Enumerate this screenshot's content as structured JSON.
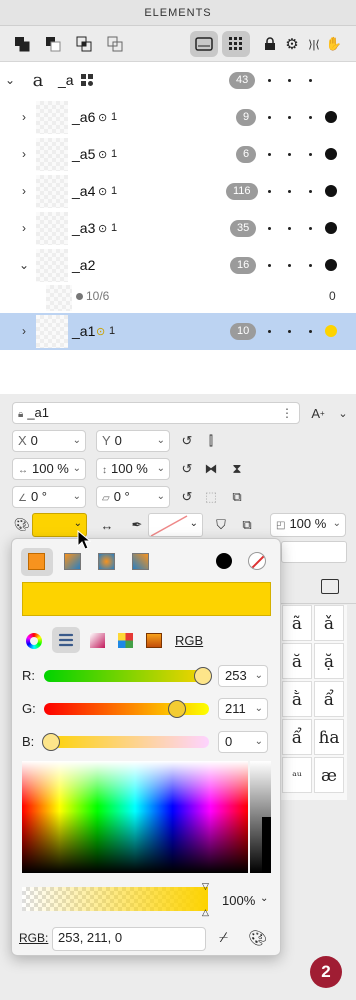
{
  "panel": {
    "title": "ELEMENTS"
  },
  "toolbar": {
    "icons": [
      "union-icon",
      "subtract-icon",
      "intersect-icon",
      "exclude-icon",
      "preview-icon",
      "grid-icon",
      "lock-icon",
      "gear-icon",
      "flip-icon",
      "hand-icon"
    ]
  },
  "layers": [
    {
      "name": "_a",
      "glyph": "a",
      "count": "43",
      "expanded": true,
      "has_component_icon": true,
      "icon": "component-icon"
    },
    {
      "name": "_a6",
      "count": "9",
      "links": "1",
      "icon": "link-icon"
    },
    {
      "name": "_a5",
      "count": "6",
      "links": "1",
      "icon": "link-icon"
    },
    {
      "name": "_a4",
      "count": "116",
      "links": "1",
      "icon": "link-icon"
    },
    {
      "name": "_a3",
      "count": "35",
      "links": "1",
      "icon": "link-icon"
    },
    {
      "name": "_a2",
      "count": "16",
      "expanded": true
    },
    {
      "name": "10/6",
      "trailing": "0",
      "sublayer": true
    },
    {
      "name": "_a1",
      "count": "10",
      "links": "1",
      "selected": true,
      "icon": "link-icon"
    }
  ],
  "properties": {
    "name_value": "_a1",
    "x_label": "X",
    "x_value": "0",
    "y_label": "Y",
    "y_value": "0",
    "width_value": "100 %",
    "height_value": "100 %",
    "rotation_value": "0 °",
    "skew_value": "0 °",
    "opacity_value": "100 %"
  },
  "color_picker": {
    "fill_modes": [
      "solid",
      "linear",
      "radial",
      "gradient"
    ],
    "color_hex": "#FDD300",
    "mode_tabs": [
      "wheel",
      "sliders",
      "gradient",
      "swatches",
      "image"
    ],
    "mode_label": "RGB",
    "r_label": "R:",
    "r_value": "253",
    "g_label": "G:",
    "g_value": "211",
    "b_label": "B:",
    "b_value": "0",
    "alpha_value": "100%",
    "rgb_label": "RGB:",
    "rgb_value": "253, 211, 0"
  },
  "glyphs": [
    "ã",
    "ǎ",
    "ă",
    "ặ",
    "ằ",
    "ẩ",
    "ẩ",
    "ɦa",
    "ᵃᵘ",
    "æ"
  ],
  "notification": {
    "count": "2"
  }
}
